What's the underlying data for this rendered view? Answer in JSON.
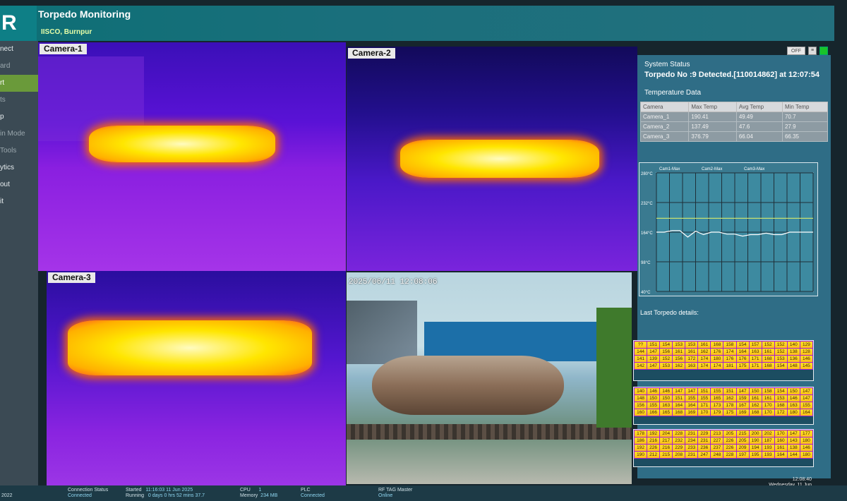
{
  "app": {
    "logo_letter": "R",
    "title": "Torpedo Monitoring",
    "subtitle": "IISCO, Burnpur"
  },
  "sidebar": {
    "items": [
      {
        "label": "nect"
      },
      {
        "label": "ard"
      },
      {
        "label": "rt"
      },
      {
        "label": "ts"
      },
      {
        "label": "p"
      },
      {
        "label": "in Mode"
      },
      {
        "label": "Tools"
      },
      {
        "label": "ytics"
      },
      {
        "label": "out"
      },
      {
        "label": "it"
      }
    ]
  },
  "cameras": [
    {
      "label": "Camera-1"
    },
    {
      "label": "Camera-2"
    },
    {
      "label": "Camera-3"
    },
    {
      "timestamp": "2025/06/11 12:08:06"
    }
  ],
  "controls": {
    "off_label": "OFF"
  },
  "status": {
    "label": "System Status",
    "message": "Torpedo No :9 Detected.[110014862] at 12:07:54"
  },
  "temperature": {
    "title": "Temperature Data",
    "columns": [
      "Camera",
      "Max Temp",
      "Avg Temp",
      "Min Temp"
    ],
    "rows": [
      [
        "Camera_1",
        "190.41",
        "49.49",
        "70.7"
      ],
      [
        "Camera_2",
        "137.49",
        "47.6",
        "27.9"
      ],
      [
        "Camera_3",
        "376.79",
        "66.04",
        "66.35"
      ]
    ]
  },
  "chart_data": {
    "type": "line",
    "legend": [
      "Cam1-Max",
      "Cam2-Max",
      "Cam3-Max"
    ],
    "y_ticks": [
      "280°C",
      "232°C",
      "164°C",
      "98°C",
      "40°C"
    ],
    "ylim": [
      40,
      280
    ],
    "x": [
      0,
      1,
      2,
      3,
      4,
      5,
      6,
      7,
      8,
      9,
      10,
      11,
      12,
      13,
      14,
      15,
      16,
      17,
      18,
      19,
      20
    ],
    "series": [
      {
        "name": "Cam1-Max",
        "color": "#ffffff",
        "values": [
          160,
          160,
          163,
          163,
          150,
          162,
          155,
          160,
          160,
          156,
          156,
          152,
          155,
          155,
          158,
          155,
          155,
          160,
          160,
          160,
          160
        ]
      },
      {
        "name": "Cam3-Max",
        "color": "#c8e070",
        "values": [
          188,
          188,
          188,
          188,
          188,
          188,
          188,
          188,
          188,
          188,
          188,
          188,
          188,
          188,
          188,
          188,
          188,
          188,
          188,
          188,
          188
        ]
      }
    ],
    "grid": true,
    "legend_position": "top"
  },
  "last_torpedo": {
    "title": "Last Torpedo details:",
    "grids": [
      [
        [
          "??",
          "151",
          "154",
          "153",
          "153",
          "161",
          "168",
          "158",
          "154",
          "157",
          "152",
          "152",
          "140",
          "129"
        ],
        [
          "144",
          "147",
          "156",
          "161",
          "161",
          "162",
          "176",
          "174",
          "164",
          "163",
          "161",
          "152",
          "138",
          "128"
        ],
        [
          "141",
          "139",
          "152",
          "156",
          "172",
          "174",
          "180",
          "176",
          "176",
          "171",
          "168",
          "153",
          "136",
          "146"
        ],
        [
          "142",
          "147",
          "153",
          "162",
          "163",
          "174",
          "174",
          "181",
          "175",
          "171",
          "168",
          "154",
          "148",
          "145"
        ]
      ],
      [
        [
          "140",
          "146",
          "146",
          "147",
          "147",
          "151",
          "155",
          "151",
          "147",
          "150",
          "158",
          "154",
          "150",
          "147"
        ],
        [
          "148",
          "150",
          "150",
          "151",
          "155",
          "155",
          "165",
          "162",
          "159",
          "161",
          "161",
          "153",
          "146",
          "147"
        ],
        [
          "156",
          "155",
          "163",
          "164",
          "164",
          "171",
          "173",
          "178",
          "167",
          "162",
          "170",
          "168",
          "163",
          "155"
        ],
        [
          "160",
          "166",
          "165",
          "168",
          "169",
          "170",
          "179",
          "175",
          "169",
          "168",
          "170",
          "172",
          "180",
          "164"
        ]
      ],
      [
        [
          "178",
          "192",
          "204",
          "228",
          "231",
          "229",
          "213",
          "205",
          "215",
          "200",
          "202",
          "170",
          "147",
          "177"
        ],
        [
          "186",
          "216",
          "217",
          "232",
          "234",
          "231",
          "227",
          "226",
          "205",
          "190",
          "187",
          "160",
          "143",
          "180"
        ],
        [
          "192",
          "226",
          "216",
          "229",
          "233",
          "236",
          "237",
          "226",
          "209",
          "194",
          "193",
          "161",
          "138",
          "146"
        ],
        [
          "190",
          "212",
          "215",
          "208",
          "231",
          "247",
          "248",
          "228",
          "197",
          "195",
          "193",
          "164",
          "144",
          "180"
        ]
      ]
    ]
  },
  "clock": {
    "time": "12:08:40",
    "date": "Wednesday, 11 Jun"
  },
  "statusbar": {
    "year": "2022",
    "connection_label": "Connection Status",
    "connection_value": "Connected",
    "started_label": "Started",
    "started_value": "11:16:03 11 Jun 2025",
    "running_label": "Running",
    "running_value": "0 days 0 hrs 52 mins 37.7",
    "cpu_label": "CPU",
    "cpu_value": "1",
    "memory_label": "Memory",
    "memory_value": "234 MB",
    "plc_label": "PLC",
    "plc_value": "Connected",
    "rftag_label": "RF TAG Master",
    "rftag_value": "Online"
  }
}
